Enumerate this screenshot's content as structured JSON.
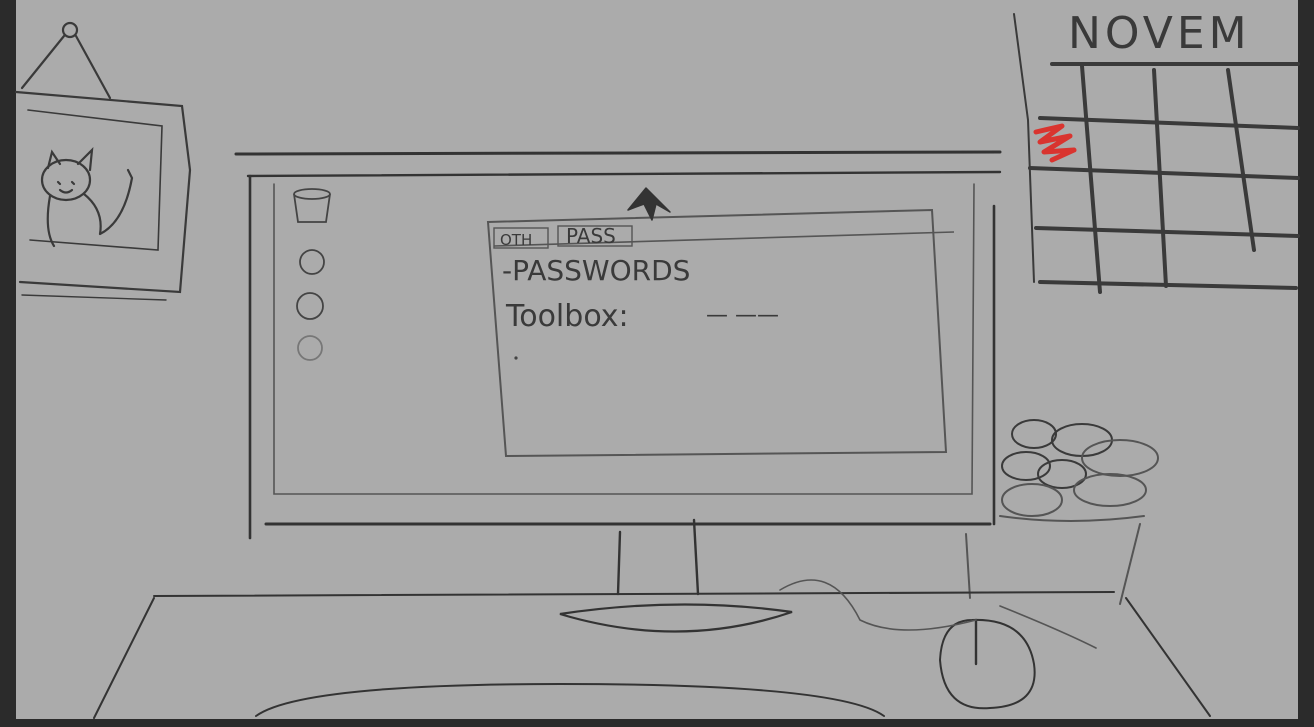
{
  "calendar": {
    "month_label": "NOVEM"
  },
  "monitor_window": {
    "tabs": [
      "OTH",
      "PASS"
    ],
    "heading": "-PASSWORDS",
    "entry_label": "Toolbox:",
    "entry_value": "— ——"
  },
  "colors": {
    "paper": "#ababab",
    "frame": "#2b2b2b",
    "ink": "#3a3a3a",
    "highlight": "#d9342f"
  },
  "icons": [
    "cat-picture-icon",
    "trash-icon",
    "cursor-icon",
    "plant-icon",
    "mouse-icon"
  ]
}
